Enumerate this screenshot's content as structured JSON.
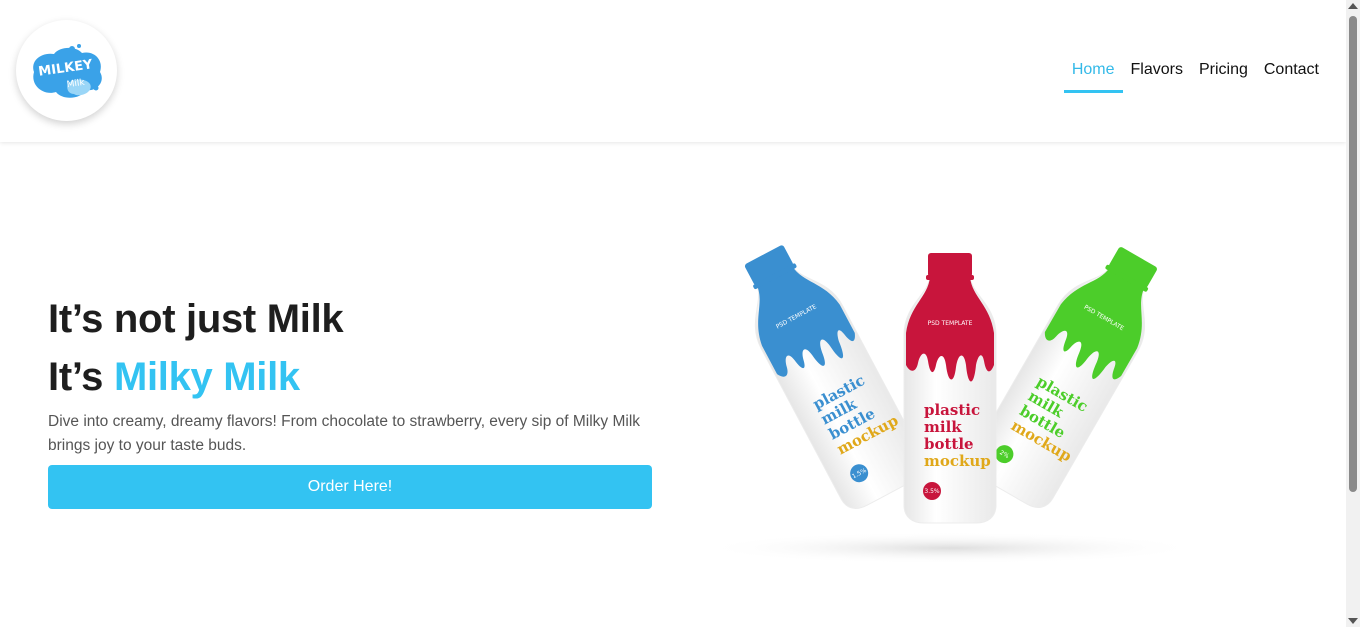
{
  "logo": {
    "line1": "MILKEY",
    "line2": "Milk"
  },
  "nav": {
    "items": [
      {
        "label": "Home",
        "active": true
      },
      {
        "label": "Flavors",
        "active": false
      },
      {
        "label": "Pricing",
        "active": false
      },
      {
        "label": "Contact",
        "active": false
      }
    ]
  },
  "hero": {
    "line1": "It’s not just Milk",
    "line2_prefix": "It’s ",
    "line2_accent": "Milky Milk",
    "description": "Dive into creamy, dreamy flavors! From chocolate to strawberry, every sip of Milky Milk brings joy to your taste buds.",
    "button_label": "Order Here!"
  },
  "bottles": [
    {
      "cap_color": "#3a8fd0",
      "accent": "#3a8fd0",
      "title": [
        "plastic",
        "milk",
        "bottle",
        "mockup"
      ],
      "percent": "1.5%",
      "band": "PSD TEMPLATE"
    },
    {
      "cap_color": "#c8153c",
      "accent": "#c8153c",
      "title": [
        "plastic",
        "milk",
        "bottle",
        "mockup"
      ],
      "percent": "3.5%",
      "band": "PSD TEMPLATE"
    },
    {
      "cap_color": "#4ccd2a",
      "accent": "#4ccd2a",
      "title": [
        "plastic",
        "milk",
        "bottle",
        "mockup"
      ],
      "percent": "2%",
      "band": "PSD TEMPLATE"
    }
  ],
  "colors": {
    "accent": "#33c3f2",
    "text": "#1e1e1e",
    "muted": "#555555"
  }
}
